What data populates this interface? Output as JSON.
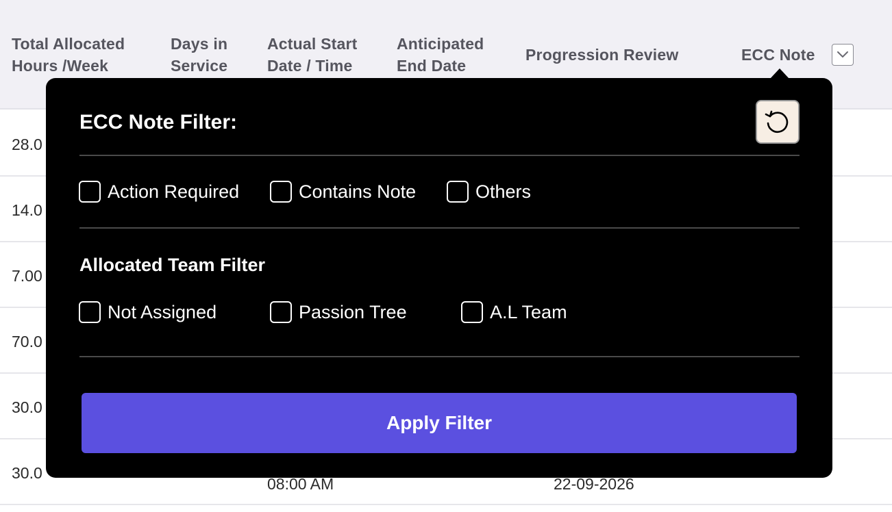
{
  "table": {
    "headers": {
      "total_hours": [
        "Total Allocated",
        "Hours /Week"
      ],
      "days_in_service": [
        "Days in",
        "Service"
      ],
      "actual_start": [
        "Actual Start",
        "Date / Time"
      ],
      "anticipated_end": [
        "Anticipated",
        "End Date"
      ],
      "progression_review": "Progression Review",
      "ecc_note": "ECC Note"
    },
    "rows": [
      "28.0",
      "14.0",
      "7.00",
      "70.0",
      "30.0",
      "30.0"
    ],
    "last_row": {
      "time": "08:00 AM",
      "date": "22-09-2026"
    }
  },
  "popover": {
    "title": "ECC Note Filter:",
    "ecc_options": [
      "Action Required",
      "Contains Note",
      "Others"
    ],
    "team_title": "Allocated Team Filter",
    "team_options": [
      "Not Assigned",
      "Passion Tree",
      "A.L Team"
    ],
    "apply_label": "Apply Filter"
  },
  "colors": {
    "accent": "#5b50e0",
    "popover_bg": "#000000",
    "header_bg": "#f1f0f5",
    "reset_bg": "#f7eee4"
  },
  "icons": {
    "reset": "reset-icon",
    "dropdown": "chevron-down-icon"
  }
}
